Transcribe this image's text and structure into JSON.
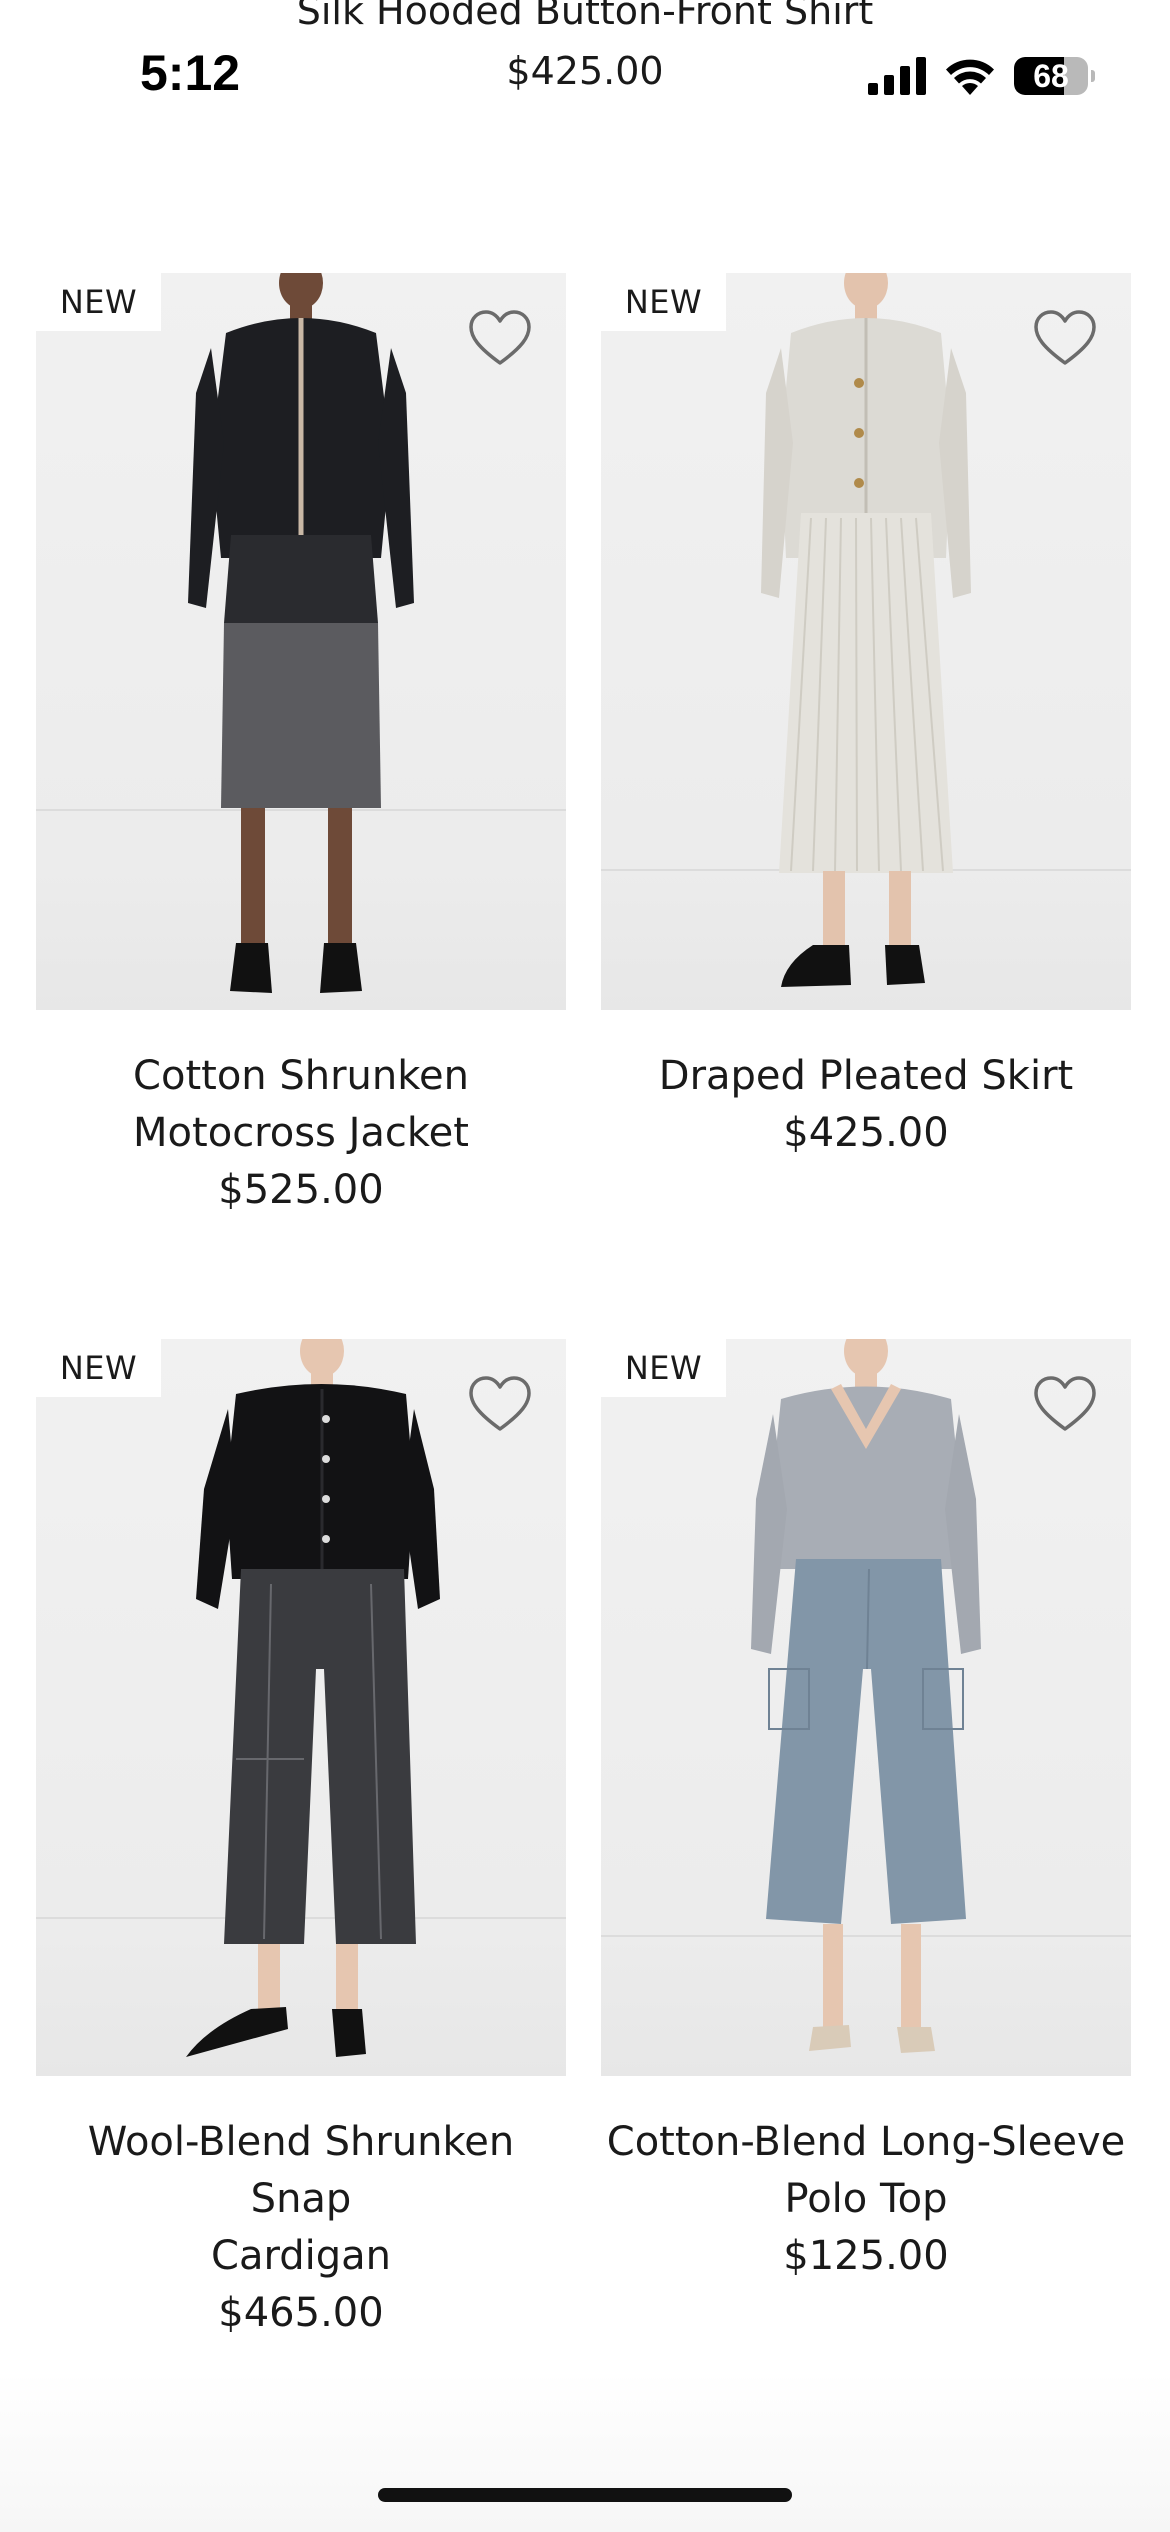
{
  "header": {
    "title": "Silk Hooded Button-Front Shirt",
    "price": "$425.00"
  },
  "status_bar": {
    "time": "5:12",
    "battery": "68",
    "battery_level": 0.68
  },
  "products": [
    {
      "badge": "NEW",
      "name": "Cotton Shrunken\nMotocross Jacket",
      "price": "$525.00",
      "image_desc": "model in black motocross jacket and sheer-hem skirt"
    },
    {
      "badge": "NEW",
      "name": "Draped Pleated Skirt",
      "price": "$425.00",
      "image_desc": "model in ribbed cream cardigan and pleated skirt"
    },
    {
      "badge": "NEW",
      "name": "Wool-Blend Shrunken Snap\nCardigan",
      "price": "$465.00",
      "image_desc": "model in black cardigan and dark denim culottes"
    },
    {
      "badge": "NEW",
      "name": "Cotton-Blend Long-Sleeve\nPolo Top",
      "price": "$125.00",
      "image_desc": "model in grey polo top and blue satin cargo culottes"
    }
  ],
  "icons": {
    "wishlist": "heart-outline-icon",
    "signal": "cellular-signal-icon",
    "wifi": "wifi-icon",
    "battery": "battery-icon"
  },
  "colors": {
    "text": "#1a1a1a",
    "image_bg": "#efefef",
    "badge_bg": "#ffffff",
    "heart_stroke": "#6b6b6b"
  }
}
